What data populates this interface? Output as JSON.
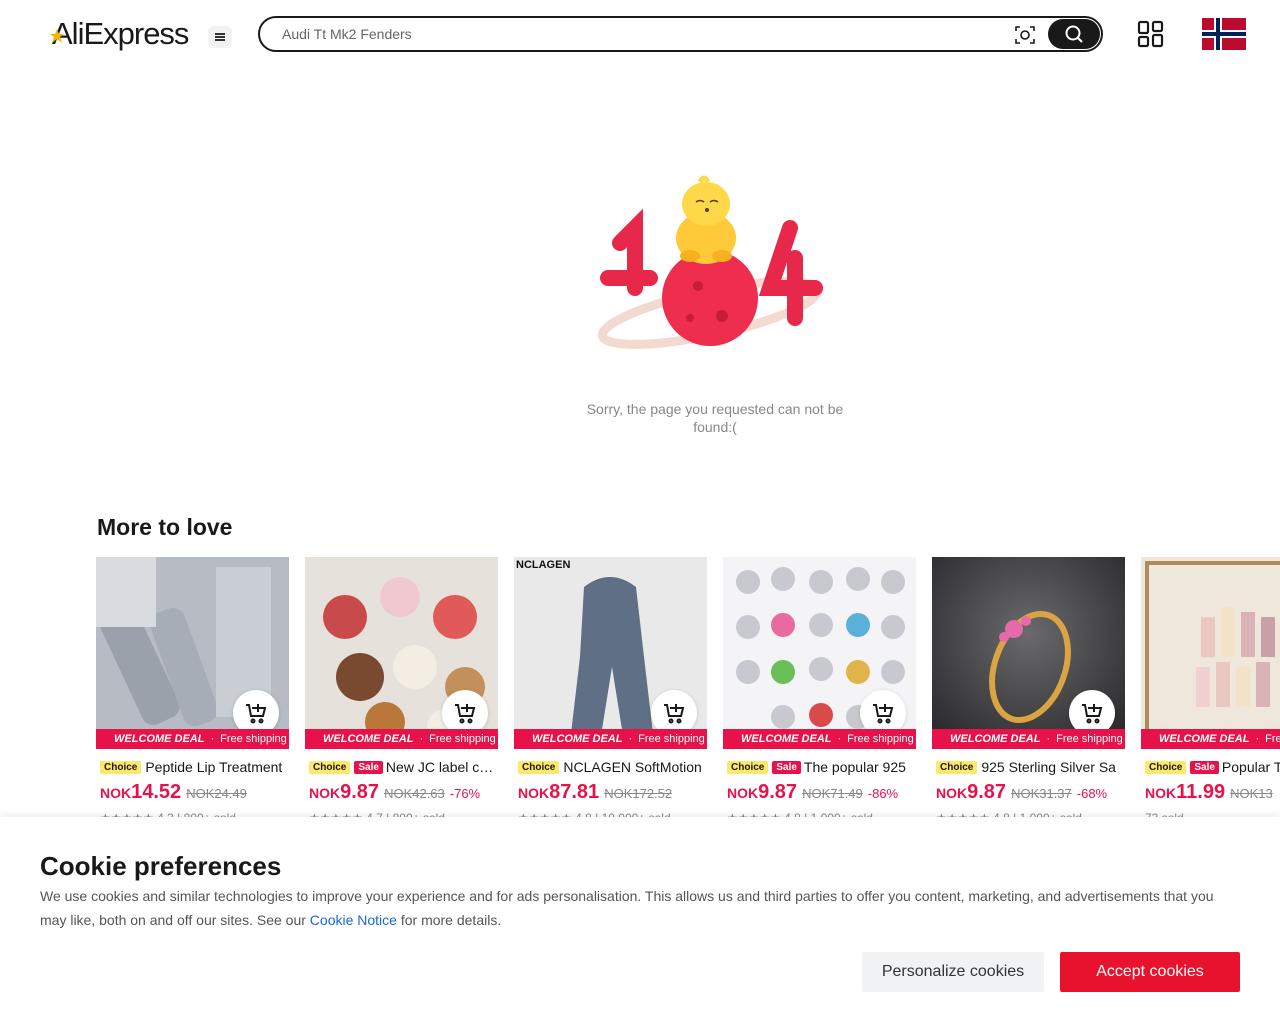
{
  "header": {
    "logo_text": "AliExpress",
    "search_placeholder": "Audi Tt Mk2 Fenders",
    "icons": [
      "menu-icon",
      "camera-search-icon",
      "search-icon",
      "qr-code-icon",
      "norway-flag-icon"
    ]
  },
  "error": {
    "message": "Sorry, the page you requested can not be found:("
  },
  "section": {
    "title": "More to love"
  },
  "deal_text": "WELCOME DEAL",
  "shipping_text": "Free shipping",
  "products": [
    {
      "choice": "Choice",
      "sale": "",
      "title": "Peptide Lip Treatment",
      "currency": "NOK",
      "price": "14.52",
      "old_price": "NOK24.49",
      "discount": "",
      "rating": "★★★★★ 4.3 | 800+ sold",
      "image_label": ""
    },
    {
      "choice": "Choice",
      "sale": "Sale",
      "title": "New JC label cute",
      "currency": "NOK",
      "price": "9.87",
      "old_price": "NOK42.63",
      "discount": "-76%",
      "rating": "★★★★★ 4.7 | 800+ sold",
      "image_label": ""
    },
    {
      "choice": "Choice",
      "sale": "",
      "title": "NCLAGEN SoftMotion",
      "currency": "NOK",
      "price": "87.81",
      "old_price": "NOK172.52",
      "discount": "",
      "rating": "★★★★★ 4.8 | 10,000+ sold",
      "image_label": "NCLAGEN"
    },
    {
      "choice": "Choice",
      "sale": "Sale",
      "title": "The popular 925",
      "currency": "NOK",
      "price": "9.87",
      "old_price": "NOK71.49",
      "discount": "-86%",
      "rating": "★★★★★ 4.8 | 1,000+ sold",
      "image_label": ""
    },
    {
      "choice": "Choice",
      "sale": "",
      "title": "925 Sterling Silver Sa",
      "currency": "NOK",
      "price": "9.87",
      "old_price": "NOK31.37",
      "discount": "-68%",
      "rating": "★★★★★ 4.8 | 1,000+ sold",
      "image_label": ""
    },
    {
      "choice": "Choice",
      "sale": "Sale",
      "title": "Popular Tr",
      "currency": "NOK",
      "price": "11.99",
      "old_price": "NOK13",
      "discount": "",
      "rating": "73 sold",
      "image_label": ""
    }
  ],
  "cookie": {
    "title": "Cookie preferences",
    "text_before": "We use cookies and similar technologies to improve your experience and for ads personalisation. This allows us and third parties to offer you content, marketing, and advertisements that you may like, both on and off our sites. See our ",
    "link": "Cookie Notice",
    "text_after": " for more details.",
    "personalize_label": "Personalize cookies",
    "accept_label": "Accept cookies"
  },
  "colors": {
    "brand_red": "#e8124a",
    "accept_red": "#e8122d",
    "choice_yellow": "#fde86b",
    "link_blue": "#1a66d9"
  }
}
